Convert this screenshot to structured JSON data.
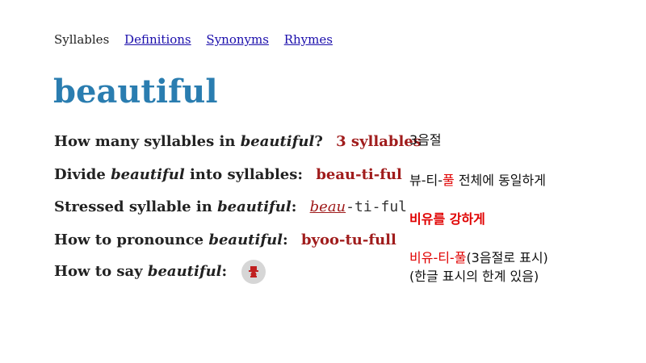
{
  "nav": {
    "current": "Syllables",
    "links": [
      "Definitions",
      "Synonyms",
      "Rhymes"
    ]
  },
  "word": "beautiful",
  "rows": {
    "count": {
      "q1": "How many syllables in ",
      "q2": "?",
      "answer": "3 syllables"
    },
    "divide": {
      "q1": "Divide ",
      "q2": " into syllables:",
      "answer": "beau-ti-ful"
    },
    "stressed": {
      "q1": "Stressed syllable in ",
      "q2": ":",
      "stressed_part": "beau",
      "rest": "-ti-ful"
    },
    "pronounce": {
      "q1": "How to pronounce ",
      "q2": ":",
      "answer": "byoo-tu-full"
    },
    "say": {
      "q1": "How to say ",
      "q2": ":"
    }
  },
  "speaker_icon": "speaker-icon",
  "notes": {
    "n1": "3음절",
    "n2_a": "뷰-티-",
    "n2_red": "풀",
    "n2_b": " 전체에 동일하게",
    "n3": "비유를 강하게",
    "n4_red": "비유-티-풀",
    "n4_b": "(3음절로 표시)",
    "n5": "(한글 표시의 한계 있음)"
  },
  "colors": {
    "title": "#2a7db0",
    "answer": "#a01c1c",
    "note_red": "#e00000",
    "link": "#1a0dab"
  }
}
